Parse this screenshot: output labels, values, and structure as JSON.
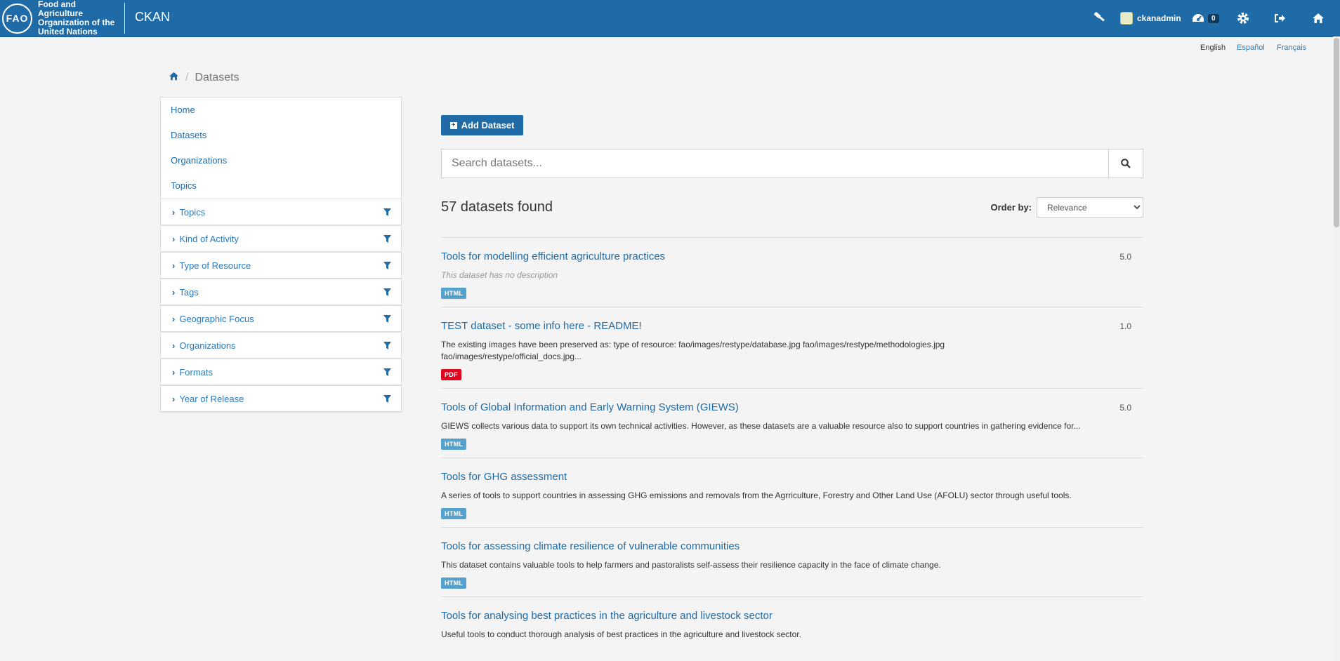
{
  "header": {
    "org_logo_text": "FAO",
    "org_name": "Food and Agriculture Organization of the United Nations",
    "site_title": "CKAN",
    "user": "ckanadmin",
    "activity_count": "0",
    "icons": [
      "gavel-icon",
      "dashboard-icon",
      "gear-icon",
      "sign-out-icon",
      "home-icon"
    ]
  },
  "languages": [
    "English",
    "Español",
    "Français"
  ],
  "breadcrumb": {
    "current": "Datasets"
  },
  "sidebar": {
    "links": [
      "Home",
      "Datasets",
      "Organizations",
      "Topics"
    ],
    "facets": [
      "Topics",
      "Kind of Activity",
      "Type of Resource",
      "Tags",
      "Geographic Focus",
      "Organizations",
      "Formats",
      "Year of Release"
    ]
  },
  "main": {
    "add_button": "Add Dataset",
    "search_placeholder": "Search datasets...",
    "found_text": "57 datasets found",
    "order_label": "Order by:",
    "order_selected": "Relevance",
    "datasets": [
      {
        "title": "Tools for modelling efficient agriculture practices",
        "score": "5.0",
        "description": "This dataset has no description",
        "format": "HTML"
      },
      {
        "title": "TEST dataset - some info here - README!",
        "score": "1.0",
        "description": "The existing images have been preserved as: type of resource: fao/images/restype/database.jpg fao/images/restype/methodologies.jpg fao/images/restype/official_docs.jpg...",
        "format": "PDF"
      },
      {
        "title": "Tools of Global Information and Early Warning System (GIEWS)",
        "score": "5.0",
        "description": "GIEWS collects various data to support its own technical activities. However, as these datasets are a valuable resource also to support countries in gathering evidence for...",
        "format": "HTML"
      },
      {
        "title": "Tools for GHG assessment",
        "score": "",
        "description": "A series of tools to support countries in assessing GHG emissions and removals from the Agrriculture, Forestry and Other Land Use (AFOLU) sector through useful tools.",
        "format": "HTML"
      },
      {
        "title": "Tools for assessing climate resilience of vulnerable communities",
        "score": "",
        "description": "This dataset contains valuable tools to help farmers and pastoralists self-assess their resilience capacity in the face of climate change.",
        "format": "HTML"
      },
      {
        "title": "Tools for analysing best practices in the agriculture and livestock sector",
        "score": "",
        "description": "Useful tools to conduct thorough analysis of best practices in the agriculture and livestock sector.",
        "format": ""
      }
    ]
  },
  "colors": {
    "header": "#1f6ba8",
    "link": "#1f6ba8",
    "html_badge": "#55a1ce",
    "pdf_badge": "#e0051e"
  }
}
